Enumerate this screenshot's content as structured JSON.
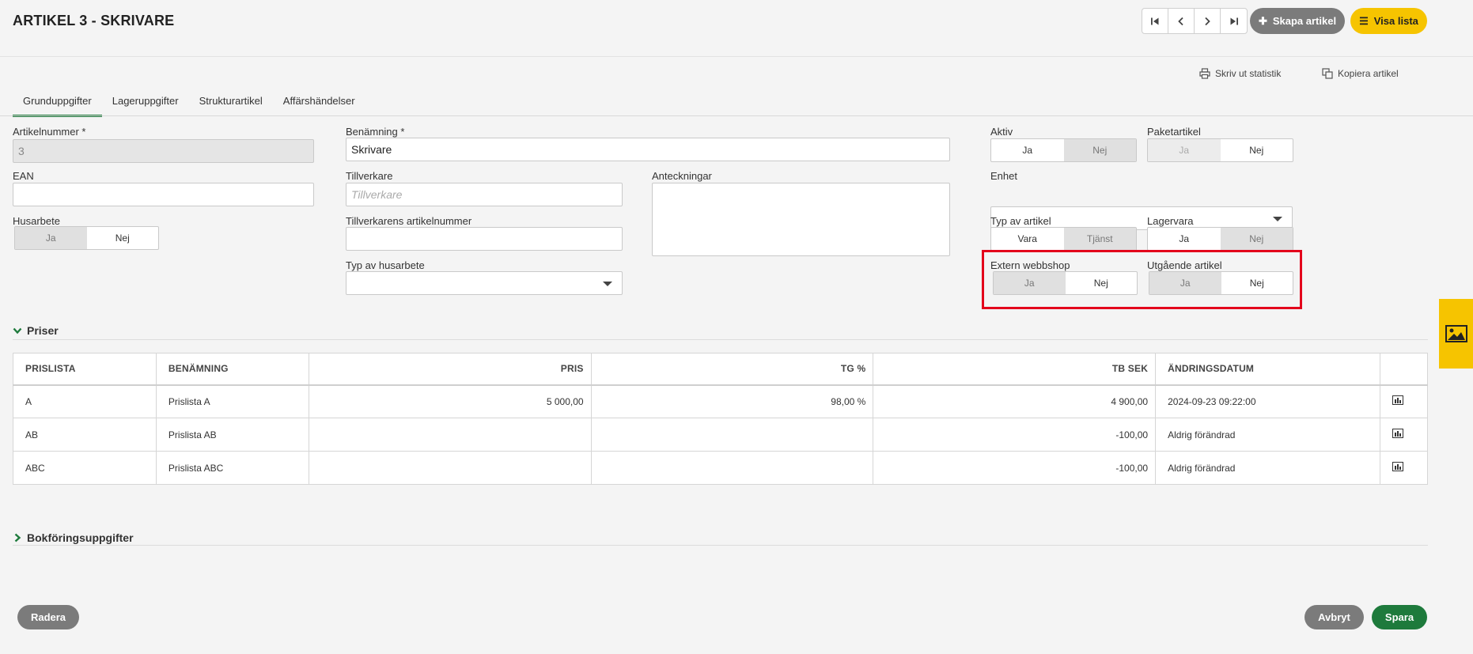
{
  "header": {
    "title": "ARTIKEL 3 - SKRIVARE",
    "create_label": "Skapa artikel",
    "list_label": "Visa lista"
  },
  "actions": {
    "print_stats": "Skriv ut statistik",
    "copy_article": "Kopiera artikel"
  },
  "tabs": [
    {
      "label": "Grunduppgifter"
    },
    {
      "label": "Lageruppgifter"
    },
    {
      "label": "Strukturartikel"
    },
    {
      "label": "Affärshändelser"
    }
  ],
  "form": {
    "article_number": {
      "label": "Artikelnummer *",
      "value": "3"
    },
    "ean": {
      "label": "EAN",
      "value": ""
    },
    "husarbete": {
      "label": "Husarbete",
      "yes": "Ja",
      "no": "Nej"
    },
    "name": {
      "label": "Benämning *",
      "value": "Skrivare"
    },
    "manufacturer": {
      "label": "Tillverkare",
      "placeholder": "Tillverkare"
    },
    "manufacturer_article_number": {
      "label": "Tillverkarens artikelnummer",
      "value": ""
    },
    "husarbete_type": {
      "label": "Typ av husarbete",
      "value": ""
    },
    "notes": {
      "label": "Anteckningar",
      "value": ""
    },
    "active": {
      "label": "Aktiv",
      "yes": "Ja",
      "no": "Nej"
    },
    "package_article": {
      "label": "Paketartikel",
      "yes": "Ja",
      "no": "Nej"
    },
    "unit": {
      "label": "Enhet",
      "value": ""
    },
    "article_type": {
      "label": "Typ av artikel",
      "option1": "Vara",
      "option2": "Tjänst"
    },
    "stock_item": {
      "label": "Lagervara",
      "yes": "Ja",
      "no": "Nej"
    },
    "external_webshop": {
      "label": "Extern webbshop",
      "yes": "Ja",
      "no": "Nej"
    },
    "outgoing_article": {
      "label": "Utgående artikel",
      "yes": "Ja",
      "no": "Nej"
    }
  },
  "prices": {
    "section_title": "Priser",
    "columns": [
      "PRISLISTA",
      "BENÄMNING",
      "PRIS",
      "TG %",
      "TB SEK",
      "ÄNDRINGSDATUM"
    ],
    "rows": [
      {
        "list": "A",
        "name": "Prislista A",
        "price": "5 000,00",
        "tg": "98,00 %",
        "tb": "4 900,00",
        "date": "2024-09-23 09:22:00"
      },
      {
        "list": "AB",
        "name": "Prislista AB",
        "price": "",
        "tg": "",
        "tb": "-100,00",
        "date": "Aldrig förändrad"
      },
      {
        "list": "ABC",
        "name": "Prislista ABC",
        "price": "",
        "tg": "",
        "tb": "-100,00",
        "date": "Aldrig förändrad"
      }
    ]
  },
  "accounting": {
    "section_title": "Bokföringsuppgifter"
  },
  "footer": {
    "delete_label": "Radera",
    "cancel_label": "Avbryt",
    "save_label": "Spara"
  },
  "colors": {
    "accent_green": "#1e7a3c",
    "accent_yellow": "#f6c400",
    "highlight_red": "#e3001b",
    "gray_button": "#7b7b7b"
  }
}
